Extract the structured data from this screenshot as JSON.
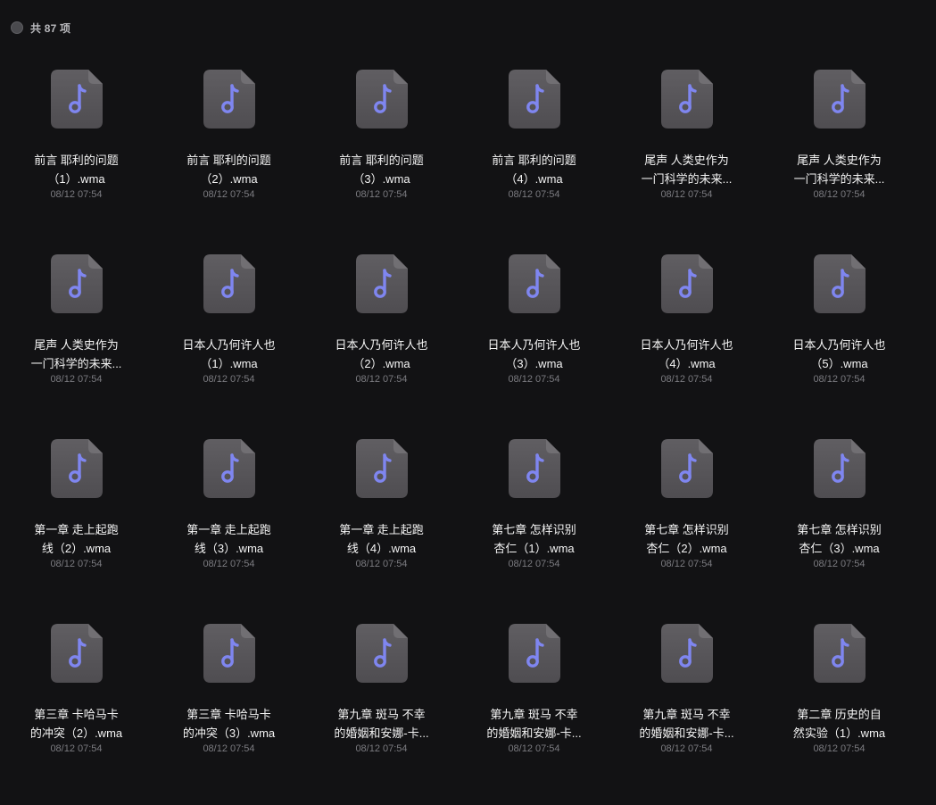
{
  "header": {
    "count_label": "共 87 项"
  },
  "icon": {
    "name": "music-file-icon",
    "color_tile": "#58565a",
    "color_note": "#7f86f0"
  },
  "files": [
    {
      "line1": "前言 耶利的问题",
      "line2": "（1）.wma",
      "date": "08/12 07:54"
    },
    {
      "line1": "前言 耶利的问题",
      "line2": "（2）.wma",
      "date": "08/12 07:54"
    },
    {
      "line1": "前言 耶利的问题",
      "line2": "（3）.wma",
      "date": "08/12 07:54"
    },
    {
      "line1": "前言 耶利的问题",
      "line2": "（4）.wma",
      "date": "08/12 07:54"
    },
    {
      "line1": "尾声 人类史作为",
      "line2": "一门科学的未来...",
      "date": "08/12 07:54"
    },
    {
      "line1": "尾声 人类史作为",
      "line2": "一门科学的未来...",
      "date": "08/12 07:54"
    },
    {
      "line1": "尾声 人类史作为",
      "line2": "一门科学的未来...",
      "date": "08/12 07:54"
    },
    {
      "line1": "日本人乃何许人也",
      "line2": "（1）.wma",
      "date": "08/12 07:54"
    },
    {
      "line1": "日本人乃何许人也",
      "line2": "（2）.wma",
      "date": "08/12 07:54"
    },
    {
      "line1": "日本人乃何许人也",
      "line2": "（3）.wma",
      "date": "08/12 07:54"
    },
    {
      "line1": "日本人乃何许人也",
      "line2": "（4）.wma",
      "date": "08/12 07:54"
    },
    {
      "line1": "日本人乃何许人也",
      "line2": "（5）.wma",
      "date": "08/12 07:54"
    },
    {
      "line1": "第一章 走上起跑",
      "line2": "线（2）.wma",
      "date": "08/12 07:54"
    },
    {
      "line1": "第一章 走上起跑",
      "line2": "线（3）.wma",
      "date": "08/12 07:54"
    },
    {
      "line1": "第一章 走上起跑",
      "line2": "线（4）.wma",
      "date": "08/12 07:54"
    },
    {
      "line1": "第七章 怎样识别",
      "line2": "杏仁（1）.wma",
      "date": "08/12 07:54"
    },
    {
      "line1": "第七章 怎样识别",
      "line2": "杏仁（2）.wma",
      "date": "08/12 07:54"
    },
    {
      "line1": "第七章 怎样识别",
      "line2": "杏仁（3）.wma",
      "date": "08/12 07:54"
    },
    {
      "line1": "第三章 卡哈马卡",
      "line2": "的冲突（2）.wma",
      "date": "08/12 07:54"
    },
    {
      "line1": "第三章 卡哈马卡",
      "line2": "的冲突（3）.wma",
      "date": "08/12 07:54"
    },
    {
      "line1": "第九章 斑马 不幸",
      "line2": "的婚姻和安娜-卡...",
      "date": "08/12 07:54"
    },
    {
      "line1": "第九章 斑马 不幸",
      "line2": "的婚姻和安娜-卡...",
      "date": "08/12 07:54"
    },
    {
      "line1": "第九章 斑马 不幸",
      "line2": "的婚姻和安娜-卡...",
      "date": "08/12 07:54"
    },
    {
      "line1": "第二章 历史的自",
      "line2": "然实验（1）.wma",
      "date": "08/12 07:54"
    }
  ]
}
